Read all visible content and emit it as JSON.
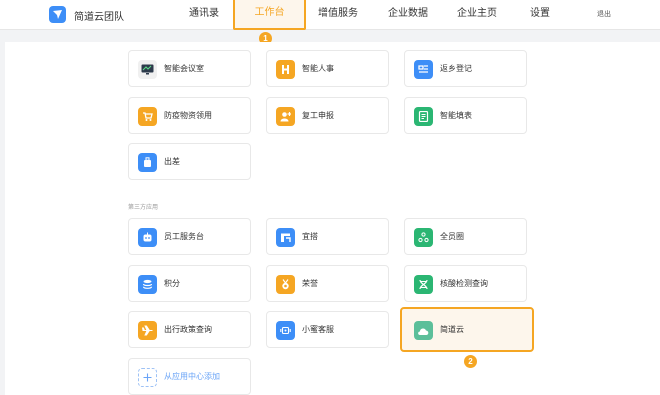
{
  "header": {
    "brand": "简道云团队",
    "nav": [
      "通讯录",
      "工作台",
      "增值服务",
      "企业数据",
      "企业主页",
      "设置"
    ],
    "logout": "退出"
  },
  "badges": [
    "1",
    "2"
  ],
  "apps": [
    {
      "label": "智能会议室",
      "icon": "monitor-icon",
      "color": "#f0f0f0"
    },
    {
      "label": "智能人事",
      "icon": "person-card-icon",
      "color": "#f5a623"
    },
    {
      "label": "返乡登记",
      "icon": "return-home-icon",
      "color": "#3d8ef7"
    },
    {
      "label": "防疫物资领用",
      "icon": "cart-icon",
      "color": "#f5a623"
    },
    {
      "label": "复工申报",
      "icon": "user-add-icon",
      "color": "#f5a623"
    },
    {
      "label": "智能填表",
      "icon": "form-icon",
      "color": "#2bb673"
    },
    {
      "label": "出差",
      "icon": "luggage-icon",
      "color": "#3d8ef7"
    }
  ],
  "third_party_label": "第三方应用",
  "third_party_apps": [
    {
      "label": "员工服务台",
      "icon": "robot-icon",
      "color": "#3d8ef7"
    },
    {
      "label": "宜搭",
      "icon": "yida-icon",
      "color": "#3d8ef7"
    },
    {
      "label": "全员圈",
      "icon": "circle-icon",
      "color": "#2bb673"
    },
    {
      "label": "积分",
      "icon": "coins-icon",
      "color": "#3d8ef7"
    },
    {
      "label": "荣誉",
      "icon": "medal-icon",
      "color": "#f5a623"
    },
    {
      "label": "核酸检测查询",
      "icon": "dna-icon",
      "color": "#2bb673"
    },
    {
      "label": "出行政策查询",
      "icon": "plane-icon",
      "color": "#f5a623"
    },
    {
      "label": "小蜜客服",
      "icon": "service-icon",
      "color": "#3d8ef7"
    },
    {
      "label": "简道云",
      "icon": "cloud-icon",
      "color": "#5cbf9a"
    }
  ],
  "add_app_label": "从应用中心添加"
}
